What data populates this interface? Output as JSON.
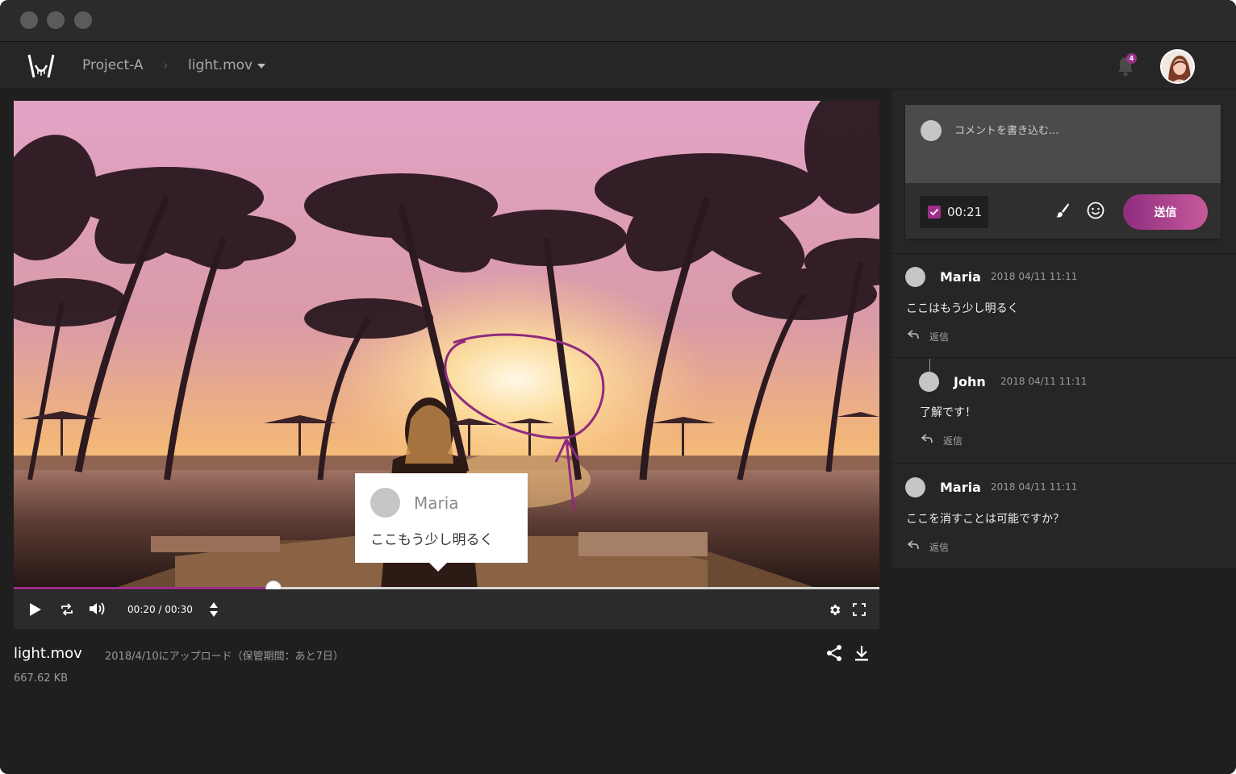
{
  "header": {
    "project": "Project-A",
    "file": "light.mov",
    "notifications_count": "4"
  },
  "player": {
    "annotation": {
      "author": "Maria",
      "text": "ここもう少し明るく"
    },
    "time_readout": "00:20 / 00:30",
    "progress_fraction": 0.3
  },
  "file_info": {
    "name": "light.mov",
    "meta": "2018/4/10にアップロード（保管期間：あと7日）",
    "size": "667.62 KB"
  },
  "composer": {
    "placeholder": "コメントを書き込む...",
    "timestamp": "00:21",
    "timestamp_checked": true,
    "send_label": "送信"
  },
  "comments": [
    {
      "author": "Maria",
      "date": "2018 04/11 11:11",
      "text": "ここはもう少し明るく",
      "reply_label": "返信"
    },
    {
      "author": "John",
      "date": "2018 04/11 11:11",
      "text": "了解です！",
      "reply_label": "返信"
    },
    {
      "author": "Maria",
      "date": "2018 04/11 11:11",
      "text": "ここを消すことは可能ですか？",
      "reply_label": "返信"
    }
  ],
  "colors": {
    "accent": "#9d2f8a",
    "background": "#1f1f1f",
    "panel": "#262626"
  }
}
